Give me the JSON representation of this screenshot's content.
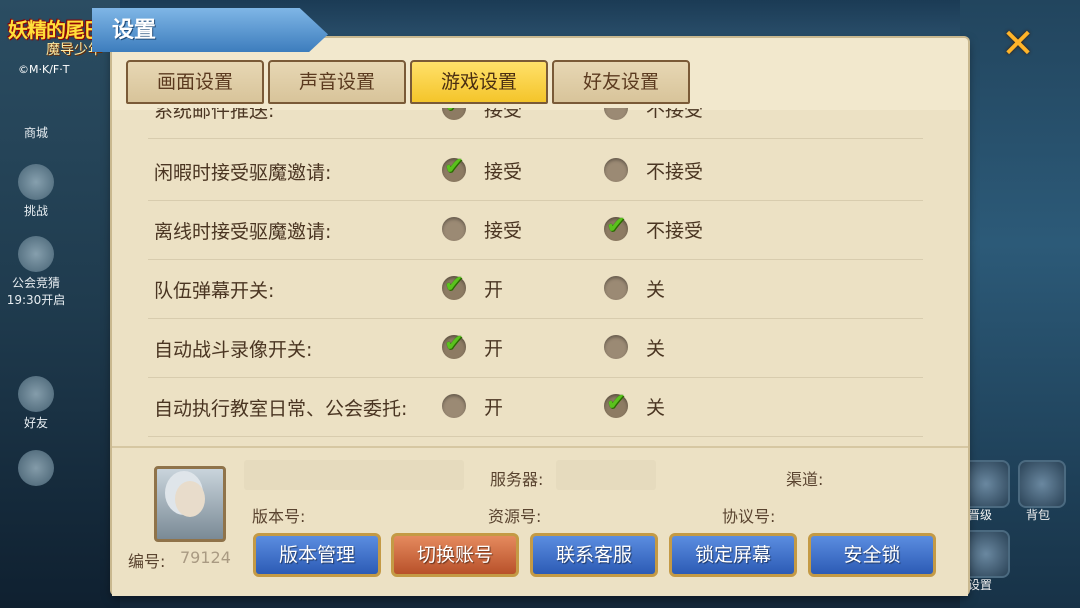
{
  "game": {
    "logo_title": "妖精的尾巴",
    "logo_subtitle": "魔导少年",
    "copyright": "©M·K/F·T"
  },
  "panel_title": "设置",
  "side_menu": [
    {
      "label": "商城"
    },
    {
      "label": "挑战"
    },
    {
      "label": "公会竞猜"
    },
    {
      "label": "19:30开启"
    },
    {
      "label": "好友"
    }
  ],
  "right_menu": [
    {
      "label": "晋级"
    },
    {
      "label": "背包"
    },
    {
      "label": "设置"
    }
  ],
  "tabs": [
    {
      "label": "画面设置",
      "active": false
    },
    {
      "label": "声音设置",
      "active": false
    },
    {
      "label": "游戏设置",
      "active": true
    },
    {
      "label": "好友设置",
      "active": false
    }
  ],
  "settings": [
    {
      "label": "系统邮件推送:",
      "options": [
        {
          "text": "接受",
          "checked": true
        },
        {
          "text": "不接受",
          "checked": false
        }
      ]
    },
    {
      "label": "闲暇时接受驱魔邀请:",
      "options": [
        {
          "text": "接受",
          "checked": true
        },
        {
          "text": "不接受",
          "checked": false
        }
      ]
    },
    {
      "label": "离线时接受驱魔邀请:",
      "options": [
        {
          "text": "接受",
          "checked": false
        },
        {
          "text": "不接受",
          "checked": true
        }
      ]
    },
    {
      "label": "队伍弹幕开关:",
      "options": [
        {
          "text": "开",
          "checked": true
        },
        {
          "text": "关",
          "checked": false
        }
      ]
    },
    {
      "label": "自动战斗录像开关:",
      "options": [
        {
          "text": "开",
          "checked": true
        },
        {
          "text": "关",
          "checked": false
        }
      ]
    },
    {
      "label": "自动执行教室日常、公会委托:",
      "options": [
        {
          "text": "开",
          "checked": false
        },
        {
          "text": "关",
          "checked": true
        }
      ]
    }
  ],
  "info": {
    "server_label": "服务器:",
    "channel_label": "渠道:",
    "version_label": "版本号:",
    "resource_label": "资源号:",
    "protocol_label": "协议号:",
    "id_label": "编号:",
    "id_value": "79124"
  },
  "buttons": [
    {
      "label": "版本管理",
      "style": "blue"
    },
    {
      "label": "切换账号",
      "style": "orange"
    },
    {
      "label": "联系客服",
      "style": "blue"
    },
    {
      "label": "锁定屏幕",
      "style": "blue"
    },
    {
      "label": "安全锁",
      "style": "blue"
    }
  ],
  "colors": {
    "panel_bg": "#ece1c4",
    "tab_active": "#f4c52a",
    "button_blue": "#2c5bb5",
    "button_orange": "#b8512a",
    "check_green": "#5ac21d"
  }
}
